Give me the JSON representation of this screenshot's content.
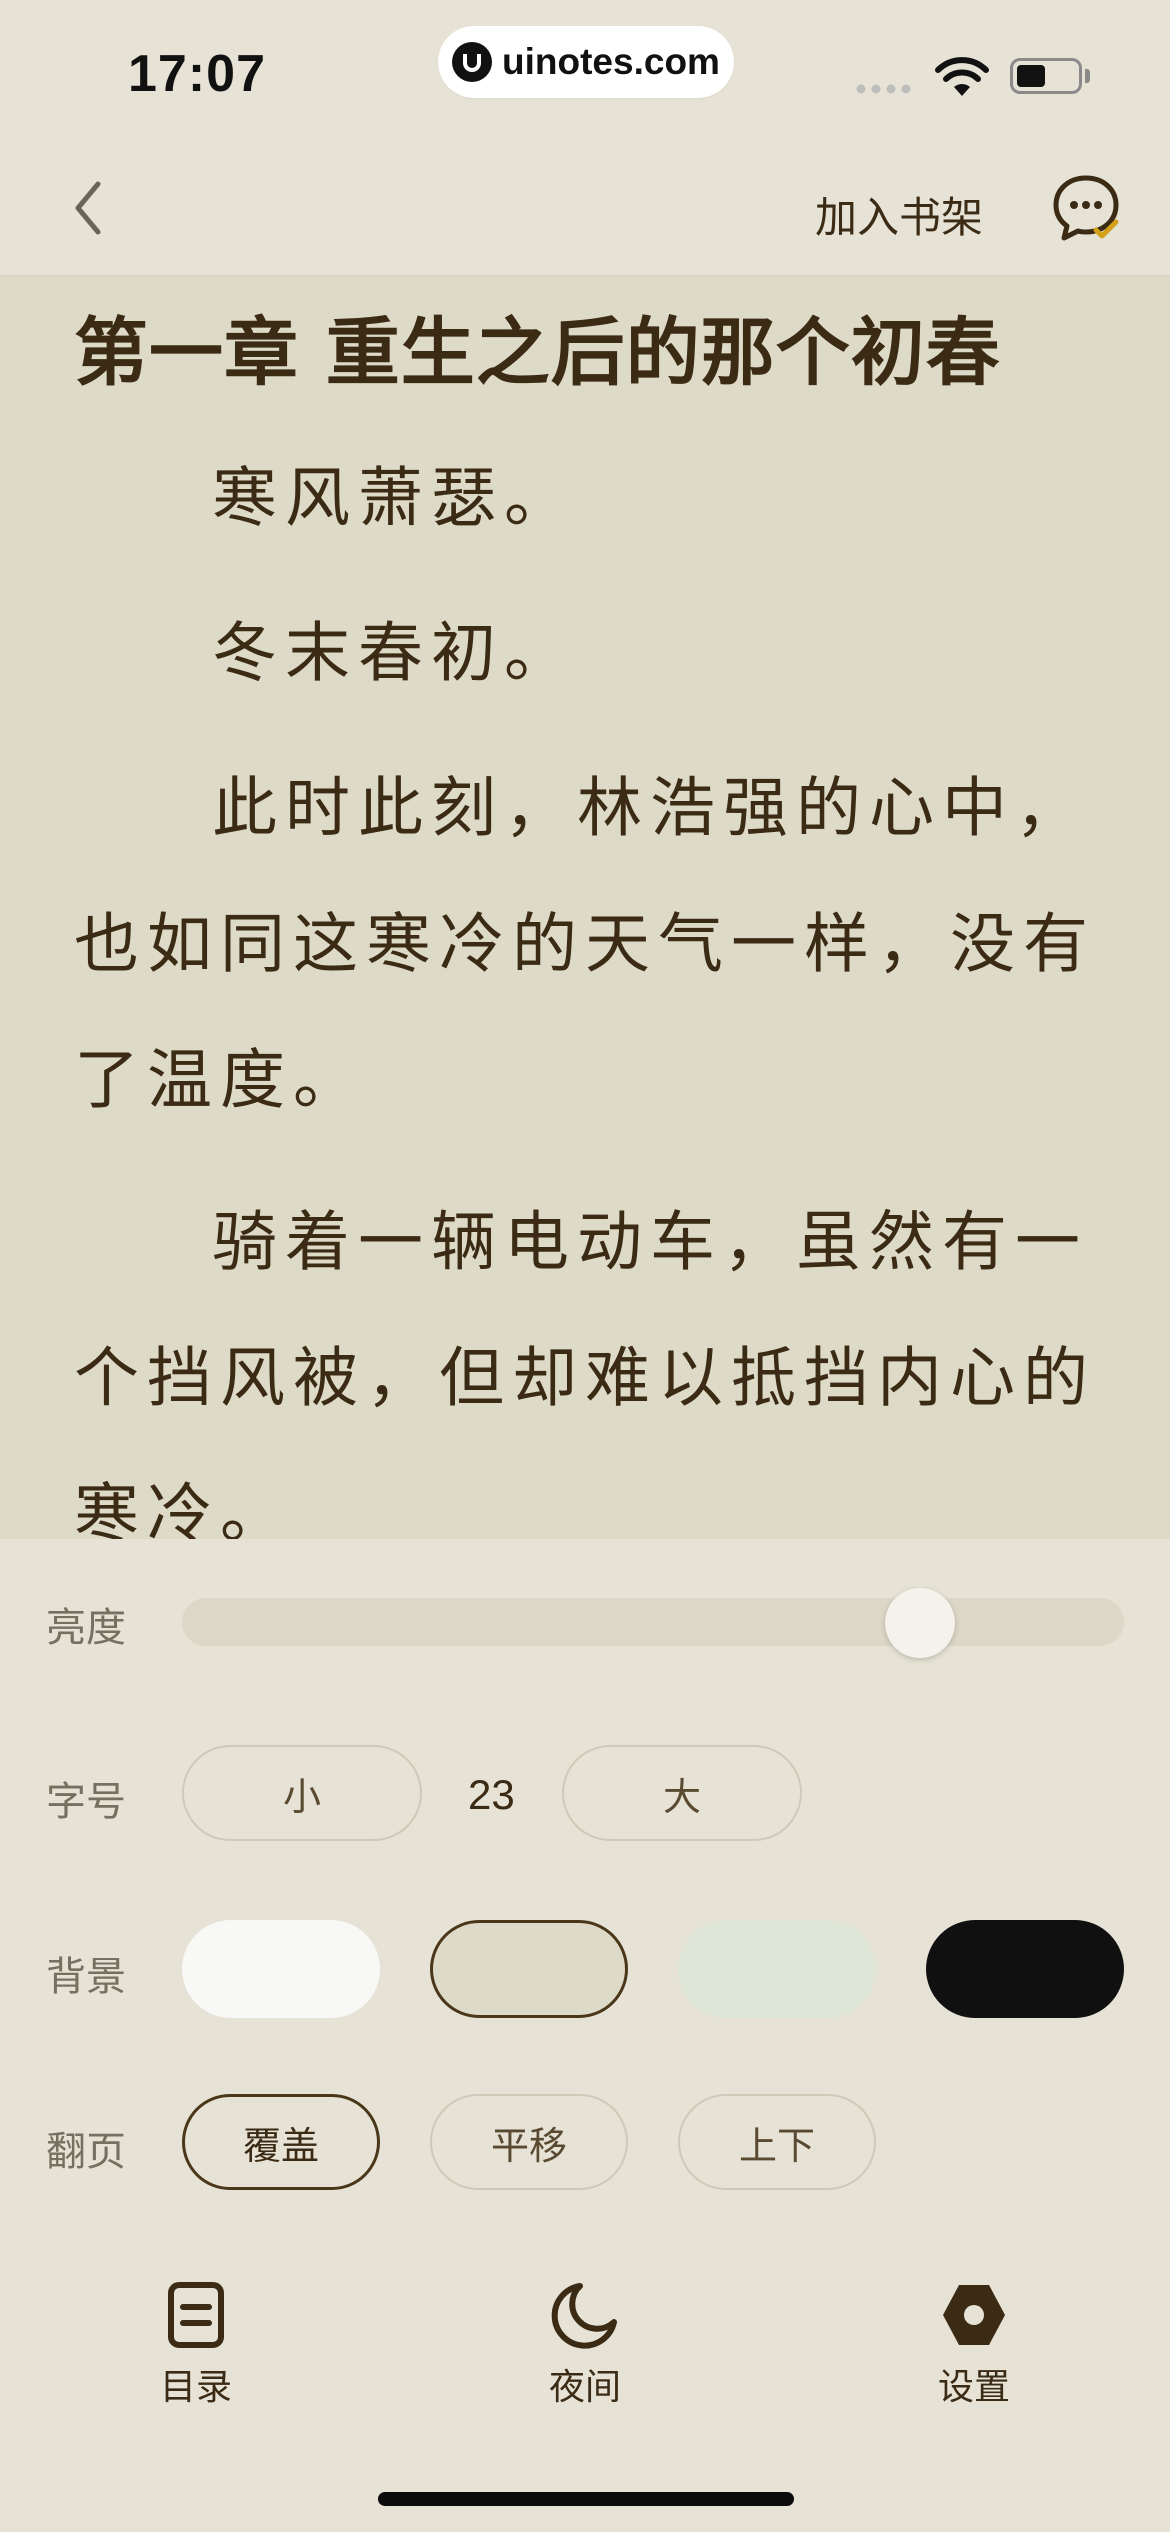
{
  "status_bar": {
    "time": "17:07",
    "watermark": "uinotes.com"
  },
  "nav": {
    "add_to_shelf": "加入书架"
  },
  "reader": {
    "chapter_title": "第一章  重生之后的那个初春",
    "paragraphs": [
      "寒风萧瑟。",
      "冬末春初。",
      "此时此刻，林浩强的心中，也如同这寒冷的天气一样，没有了温度。",
      "骑着一辆电动车，虽然有一个挡风被，但却难以抵挡内心的寒冷。"
    ]
  },
  "settings": {
    "brightness_label": "亮度",
    "brightness_level": 0.79,
    "font_label": "字号",
    "font_small": "小",
    "font_size": "23",
    "font_large": "大",
    "background_label": "背景",
    "backgrounds": [
      {
        "name": "white",
        "color": "#f8f8f6",
        "selected": false
      },
      {
        "name": "beige",
        "color": "#dedac8",
        "selected": true
      },
      {
        "name": "green",
        "color": "#dde5d6",
        "selected": false
      },
      {
        "name": "black",
        "color": "#101010",
        "selected": false
      }
    ],
    "page_turn_label": "翻页",
    "page_turn_options": [
      "覆盖",
      "平移",
      "上下"
    ],
    "page_turn_selected": "覆盖"
  },
  "bottom_tabs": {
    "toc": "目录",
    "night": "夜间",
    "settings": "设置"
  },
  "colors": {
    "accent": "#3b2a14",
    "comment_check": "#d4a017"
  }
}
